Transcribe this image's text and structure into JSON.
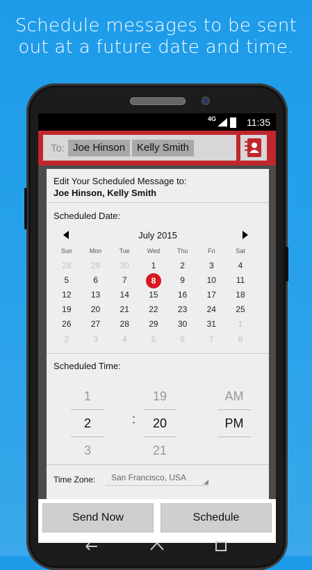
{
  "tagline": "Schedule messages to be sent out at a future date and time.",
  "status_bar": {
    "network": "4G LTE",
    "time": "11:35"
  },
  "recipients": {
    "to_label": "To:",
    "chips": [
      "Joe Hinson",
      "Kelly Smith"
    ]
  },
  "dialog": {
    "title": "Edit Your Scheduled Message to:",
    "names": "Joe Hinson, Kelly Smith",
    "date_label": "Scheduled Date:",
    "calendar": {
      "month": "July 2015",
      "weekdays": [
        "Sun",
        "Mon",
        "Tue",
        "Wed",
        "Thu",
        "Fri",
        "Sat"
      ],
      "weeks": [
        [
          "28",
          "29",
          "30",
          "1",
          "2",
          "3",
          "4"
        ],
        [
          "5",
          "6",
          "7",
          "8",
          "9",
          "10",
          "11"
        ],
        [
          "12",
          "13",
          "14",
          "15",
          "16",
          "17",
          "18"
        ],
        [
          "19",
          "20",
          "21",
          "22",
          "23",
          "24",
          "25"
        ],
        [
          "26",
          "27",
          "28",
          "29",
          "30",
          "31",
          "1"
        ],
        [
          "2",
          "3",
          "4",
          "5",
          "6",
          "7",
          "8"
        ]
      ],
      "selected_day": "8"
    },
    "time_label": "Scheduled Time:",
    "time": {
      "hour": {
        "prev": "1",
        "current": "2",
        "next": "3"
      },
      "separator": ":",
      "minute": {
        "prev": "19",
        "current": "20",
        "next": "21"
      },
      "period": {
        "prev": "AM",
        "current": "PM"
      }
    },
    "timezone_label": "Time Zone:",
    "timezone_value": "San Francisco, USA"
  },
  "buttons": {
    "send_now": "Send Now",
    "schedule": "Schedule"
  },
  "colors": {
    "background": "#1d9be9",
    "app_bar": "#c0272d",
    "selected_day": "#d7191f"
  }
}
